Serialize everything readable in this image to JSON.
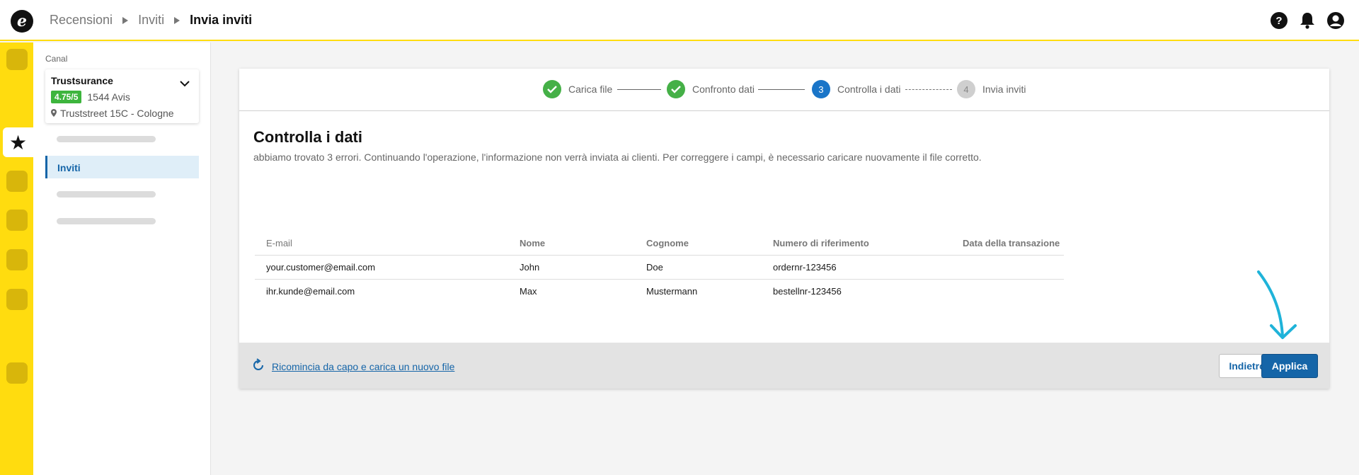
{
  "header": {
    "logo_letter": "e",
    "breadcrumbs": [
      "Recensioni",
      "Inviti"
    ],
    "current": "Invia inviti"
  },
  "sidebar": {
    "label": "Canal",
    "channel": {
      "name": "Trustsurance",
      "rating": "4.75/5",
      "reviews": "1544 Avis",
      "address": "Truststreet 15C - Cologne"
    },
    "active_item": "Inviti"
  },
  "stepper": {
    "steps": [
      {
        "number": "1",
        "label": "Carica file",
        "state": "done"
      },
      {
        "number": "2",
        "label": "Confronto dati",
        "state": "done"
      },
      {
        "number": "3",
        "label": "Controlla i dati",
        "state": "current"
      },
      {
        "number": "4",
        "label": "Invia inviti",
        "state": "todo"
      }
    ]
  },
  "main": {
    "title": "Controlla i dati",
    "description": "abbiamo trovato 3 errori. Continuando l'operazione, l'informazione non verrà inviata ai clienti. Per correggere i campi, è necessario caricare nuovamente il file corretto."
  },
  "table": {
    "columns": [
      "E-mail",
      "Nome",
      "Cognome",
      "Numero di riferimento",
      "Data della transazione"
    ],
    "rows": [
      [
        "your.customer@email.com",
        "John",
        "Doe",
        "ordernr-123456",
        ""
      ],
      [
        "ihr.kunde@email.com",
        "Max",
        "Mustermann",
        "bestellnr-123456",
        ""
      ]
    ]
  },
  "footer": {
    "restart_link": "Ricomincia da capo e carica un nuovo file",
    "back_button": "Indietro",
    "apply_button": "Applica"
  },
  "colors": {
    "brand_yellow": "#ffdc0f",
    "primary_blue": "#1565a8",
    "success_green": "#45b047",
    "annotation_cyan": "#1fb3d9"
  }
}
